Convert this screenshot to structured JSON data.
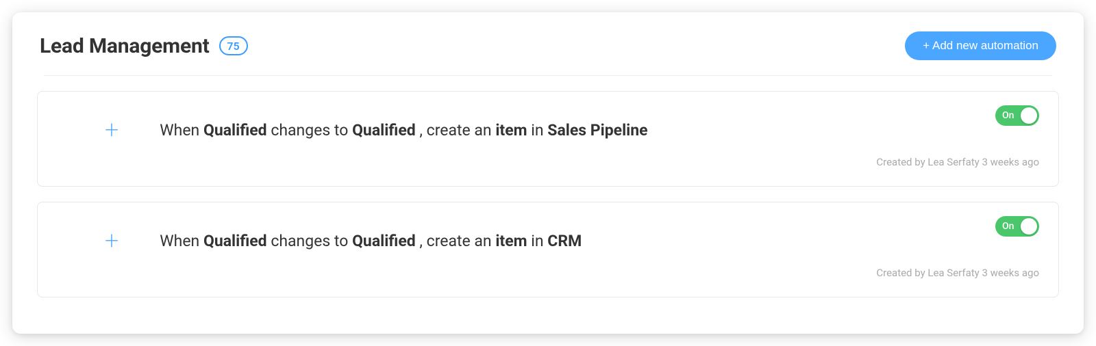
{
  "header": {
    "title": "Lead Management",
    "count": "75",
    "add_button": "+ Add new automation"
  },
  "toggle_label": "On",
  "automations": [
    {
      "when": "When",
      "column": "Qualified",
      "changes_to": "changes to",
      "value": "Qualified",
      "create_an": ", create an",
      "item": "item",
      "in": "in",
      "target": "Sales Pipeline",
      "created_by": "Created by Lea Serfaty 3 weeks ago"
    },
    {
      "when": "When",
      "column": "Qualified",
      "changes_to": "changes to",
      "value": "Qualified",
      "create_an": ", create an",
      "item": "item",
      "in": "in",
      "target": "CRM",
      "created_by": "Created by Lea Serfaty 3 weeks ago"
    }
  ]
}
